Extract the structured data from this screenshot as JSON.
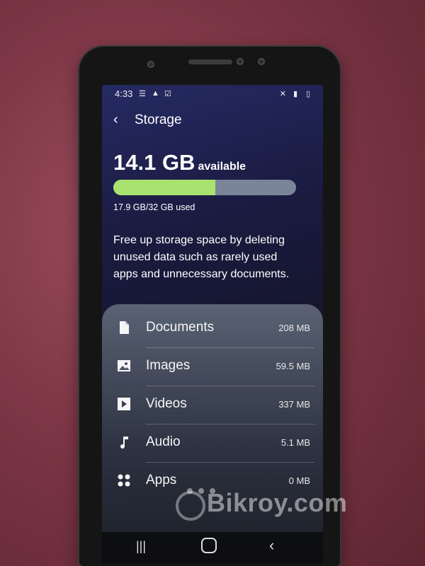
{
  "status_bar": {
    "time": "4:33"
  },
  "header": {
    "title": "Storage"
  },
  "summary": {
    "available_value": "14.1 GB",
    "available_label": "available",
    "used_text": "17.9 GB/32 GB used",
    "used_fraction": 0.559
  },
  "description": "Free up storage space by deleting unused data such as rarely used apps and unnecessary documents.",
  "categories": [
    {
      "name": "Documents",
      "size": "208 MB",
      "icon": "document-icon"
    },
    {
      "name": "Images",
      "size": "59.5 MB",
      "icon": "image-icon"
    },
    {
      "name": "Videos",
      "size": "337 MB",
      "icon": "video-icon"
    },
    {
      "name": "Audio",
      "size": "5.1 MB",
      "icon": "audio-icon"
    },
    {
      "name": "Apps",
      "size": "0 MB",
      "icon": "apps-icon"
    }
  ],
  "watermark": "Bikroy.com",
  "colors": {
    "bar_fill": "#a8e26f",
    "bar_track": "#7a8599"
  }
}
